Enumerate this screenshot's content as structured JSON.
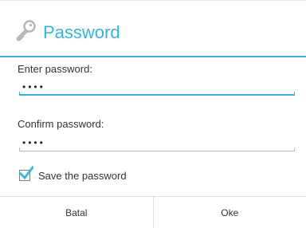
{
  "dialog": {
    "title": "Password",
    "icon": "key-icon",
    "accent_color": "#33b5e5"
  },
  "fields": {
    "enter": {
      "label": "Enter password:",
      "value": "••••"
    },
    "confirm": {
      "label": "Confirm password:",
      "value": "••••"
    }
  },
  "save_option": {
    "label": "Save the password",
    "checked": true
  },
  "buttons": {
    "cancel_label": "Batal",
    "ok_label": "Oke"
  }
}
